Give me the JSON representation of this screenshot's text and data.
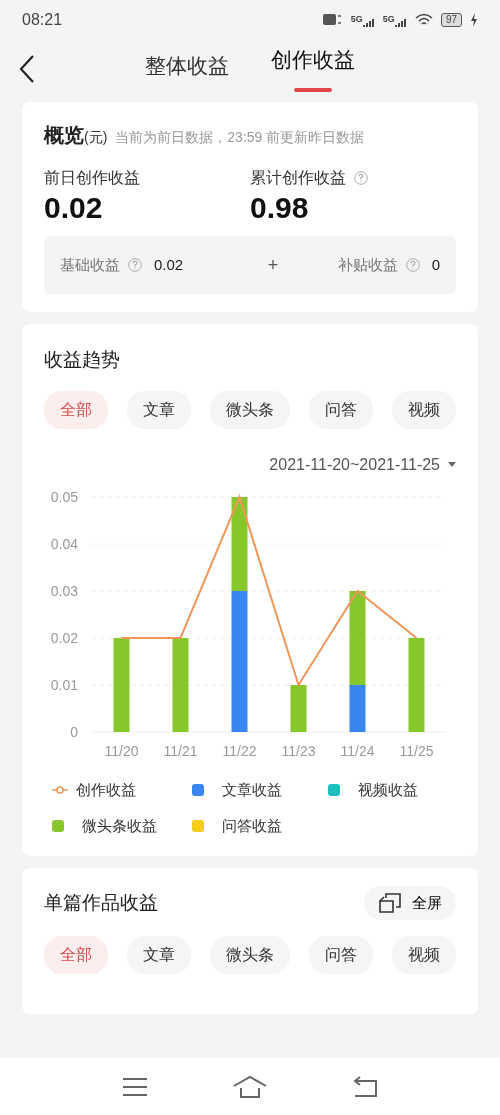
{
  "status_bar": {
    "time": "08:21",
    "network_labels": [
      "5G",
      "5G"
    ],
    "battery": "97"
  },
  "header": {
    "tabs": [
      {
        "label": "整体收益",
        "selected": false
      },
      {
        "label": "创作收益",
        "selected": true
      }
    ]
  },
  "overview": {
    "title": "概览",
    "unit": "(元)",
    "note": "当前为前日数据，23:59 前更新昨日数据",
    "stats": [
      {
        "label": "前日创作收益",
        "value": "0.02",
        "help": false
      },
      {
        "label": "累计创作收益",
        "value": "0.98",
        "help": true
      }
    ],
    "breakdown": [
      {
        "label": "基础收益",
        "value": "0.02"
      },
      {
        "label": "补贴收益",
        "value": "0"
      }
    ],
    "operator": "+"
  },
  "trend": {
    "title": "收益趋势",
    "filters": [
      {
        "label": "全部",
        "selected": true
      },
      {
        "label": "文章",
        "selected": false
      },
      {
        "label": "微头条",
        "selected": false
      },
      {
        "label": "问答",
        "selected": false
      },
      {
        "label": "视频",
        "selected": false
      }
    ],
    "date_range": "2021-11-20~2021-11-25",
    "chart_data": {
      "type": "bar",
      "stacked": true,
      "grid": true,
      "categories": [
        "11/20",
        "11/21",
        "11/22",
        "11/23",
        "11/24",
        "11/25"
      ],
      "ylim": [
        0,
        0.05
      ],
      "yticks": [
        {
          "value": 0,
          "label": "0"
        },
        {
          "value": 0.01,
          "label": "0.01"
        },
        {
          "value": 0.02,
          "label": "0.02"
        },
        {
          "value": 0.03,
          "label": "0.03"
        },
        {
          "value": 0.04,
          "label": "0.04"
        },
        {
          "value": 0.05,
          "label": "0.05"
        }
      ],
      "series": [
        {
          "name": "创作收益",
          "type": "line",
          "color": "#f0965a",
          "values": [
            0.02,
            0.02,
            0.05,
            0.01,
            0.03,
            0.02
          ]
        },
        {
          "name": "文章收益",
          "type": "bar",
          "color": "#3a86f0",
          "values": [
            0,
            0,
            0.03,
            0,
            0.01,
            0
          ]
        },
        {
          "name": "视频收益",
          "type": "bar",
          "color": "#1dbfbf",
          "values": [
            0,
            0,
            0,
            0,
            0,
            0
          ]
        },
        {
          "name": "微头条收益",
          "type": "bar",
          "color": "#86c82c",
          "values": [
            0.02,
            0.02,
            0.02,
            0.01,
            0.02,
            0.02
          ]
        },
        {
          "name": "问答收益",
          "type": "bar",
          "color": "#f7cc1a",
          "values": [
            0,
            0,
            0,
            0,
            0,
            0
          ]
        }
      ]
    }
  },
  "single_works": {
    "title": "单篇作品收益",
    "fullscreen_label": "全屏",
    "filters": [
      {
        "label": "全部",
        "selected": true
      },
      {
        "label": "文章",
        "selected": false
      },
      {
        "label": "微头条",
        "selected": false
      },
      {
        "label": "问答",
        "selected": false
      },
      {
        "label": "视频",
        "selected": false
      }
    ]
  }
}
